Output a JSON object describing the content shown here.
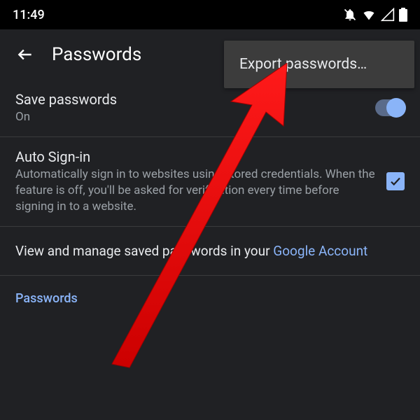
{
  "status": {
    "time": "11:49"
  },
  "appbar": {
    "title": "Passwords"
  },
  "menu": {
    "export": "Export passwords…"
  },
  "rows": {
    "save": {
      "title": "Save passwords",
      "sub": "On"
    },
    "auto": {
      "title": "Auto Sign-in",
      "sub": "Automatically sign in to websites using stored credentials. When the feature is off, you'll be asked for verification every time before signing in to a website."
    }
  },
  "manage": {
    "prefix": "View and manage saved passwords in your ",
    "link": "Google Account"
  },
  "section": {
    "passwords": "Passwords"
  }
}
